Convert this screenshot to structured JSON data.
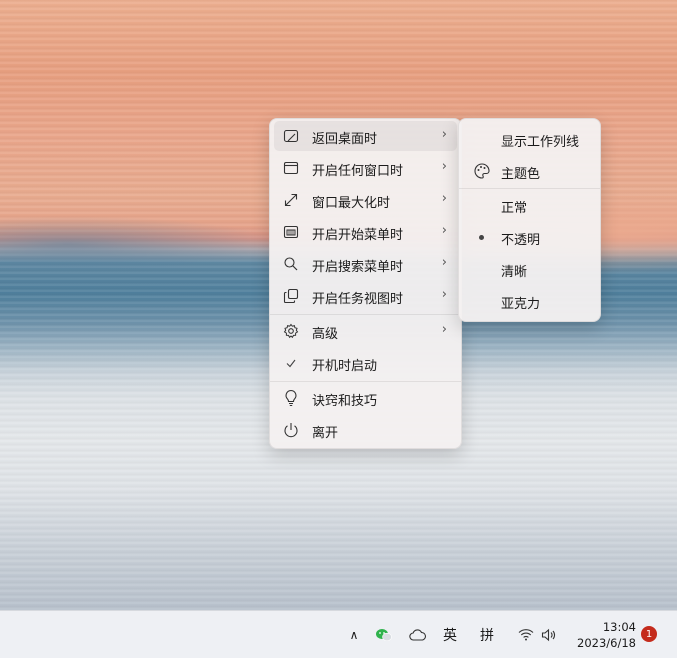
{
  "main_menu": {
    "items": [
      {
        "label": "返回桌面时",
        "icon": "desktop-icon",
        "has_submenu": true
      },
      {
        "label": "开启任何窗口时",
        "icon": "window-icon",
        "has_submenu": true
      },
      {
        "label": "窗口最大化时",
        "icon": "maximize-icon",
        "has_submenu": true
      },
      {
        "label": "开启开始菜单时",
        "icon": "start-menu-icon",
        "has_submenu": true
      },
      {
        "label": "开启搜索菜单时",
        "icon": "search-icon",
        "has_submenu": true
      },
      {
        "label": "开启任务视图时",
        "icon": "task-view-icon",
        "has_submenu": true
      },
      {
        "label": "高级",
        "icon": "gear-icon",
        "has_submenu": true
      },
      {
        "label": "开机时启动",
        "icon": "checkmark-icon",
        "checked": true
      },
      {
        "label": "诀窍和技巧",
        "icon": "lightbulb-icon"
      },
      {
        "label": "离开",
        "icon": "power-icon"
      }
    ],
    "chevron": "›"
  },
  "submenu": {
    "items": [
      {
        "label": "显示工作列线"
      },
      {
        "label": "主题色",
        "icon": "palette-icon"
      },
      {
        "label": "正常"
      },
      {
        "label": "不透明",
        "selected": true
      },
      {
        "label": "清晰"
      },
      {
        "label": "亚克力"
      }
    ]
  },
  "taskbar": {
    "show_hidden_icons": "∧",
    "ime_lang": "英",
    "ime_mode": "拼",
    "time": "13:04",
    "date": "2023/6/18",
    "notification_count": "1",
    "colors": {
      "badge": "#c42b1c",
      "wechat": "#2fb24c"
    }
  }
}
